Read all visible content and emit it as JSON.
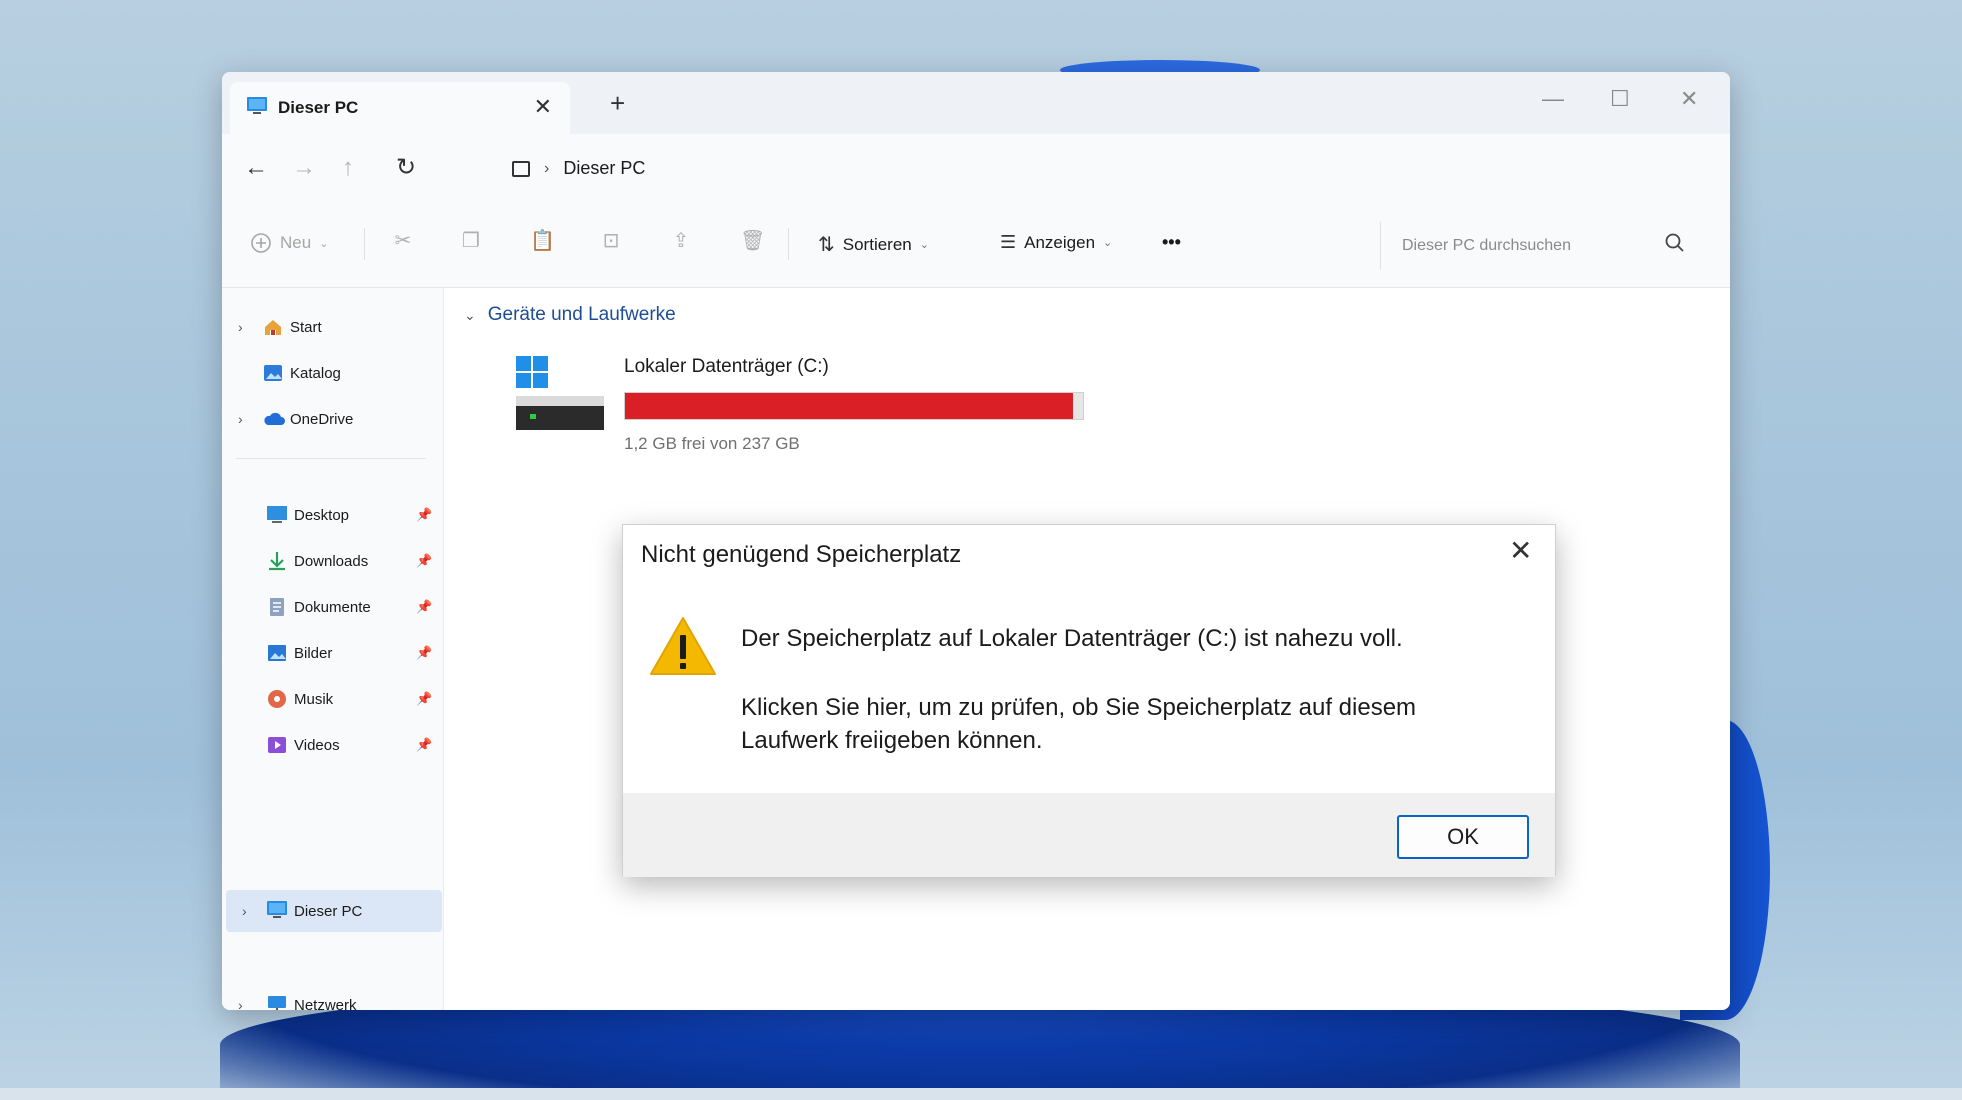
{
  "window": {
    "tab_title": "Dieser PC",
    "tab_close": "✕",
    "new_tab": "+",
    "minimize": "—",
    "maximize": "☐",
    "close": "✕"
  },
  "navbar": {
    "back": "←",
    "forward": "→",
    "up": "↑",
    "refresh": "↻",
    "breadcrumb": [
      "Dieser PC"
    ]
  },
  "toolbar": {
    "new_label": "Neu",
    "sort_label": "Sortieren",
    "view_label": "Anzeigen",
    "more_label": "•••",
    "search_placeholder": "Dieser PC durchsuchen"
  },
  "sidebar": {
    "items": [
      {
        "label": "Start",
        "expandable": true
      },
      {
        "label": "Katalog",
        "expandable": false
      },
      {
        "label": "OneDrive",
        "expandable": true
      },
      {
        "label": "Desktop",
        "pinned": true
      },
      {
        "label": "Downloads",
        "pinned": true
      },
      {
        "label": "Dokumente",
        "pinned": true
      },
      {
        "label": "Bilder",
        "pinned": true
      },
      {
        "label": "Musik",
        "pinned": true
      },
      {
        "label": "Videos",
        "pinned": true
      },
      {
        "label": "Dieser PC",
        "expandable": true,
        "selected": true
      },
      {
        "label": "Netzwerk",
        "expandable": true
      }
    ]
  },
  "content": {
    "group_title": "Geräte und Laufwerke",
    "drive": {
      "name": "Lokaler Datenträger (C:)",
      "free_text": "1,2 GB frei von 237 GB",
      "used_fraction": 0.978,
      "bar_color": "#da2026"
    }
  },
  "dialog": {
    "title": "Nicht genügend Speicherplatz",
    "close": "✕",
    "message1": "Der Speicherplatz auf Lokaler Datenträger (C:) ist nahezu voll.",
    "message2": "Klicken Sie hier, um zu prüfen, ob Sie Speicherplatz auf diesem Laufwerk freiigeben können.",
    "ok_label": "OK"
  },
  "colors": {
    "accent": "#0a64c8",
    "link": "#1e4d94",
    "warning": "#f5b800"
  }
}
